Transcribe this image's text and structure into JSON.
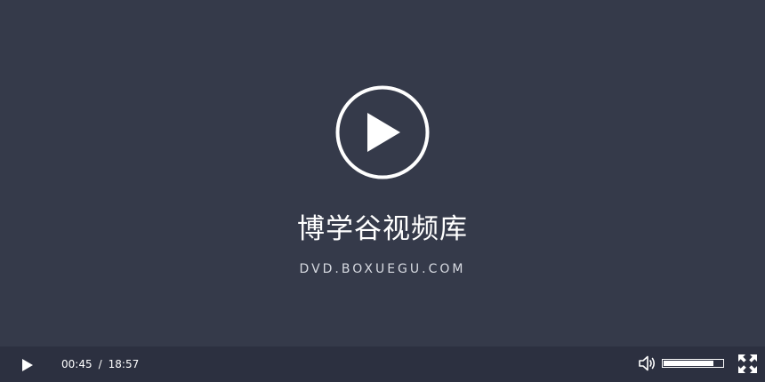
{
  "poster": {
    "title": "博学谷视频库",
    "url": "DVD.BOXUEGU.COM"
  },
  "controls": {
    "current_time": "00:45",
    "separator": "/",
    "duration": "18:57",
    "volume_level": 0.85,
    "icons": {
      "big_play": "play-circle-icon",
      "play": "play-icon",
      "volume": "volume-icon",
      "fullscreen": "fullscreen-icon"
    }
  },
  "colors": {
    "background": "#353a4a",
    "control_bar": "#2c3040",
    "foreground": "#ffffff"
  }
}
